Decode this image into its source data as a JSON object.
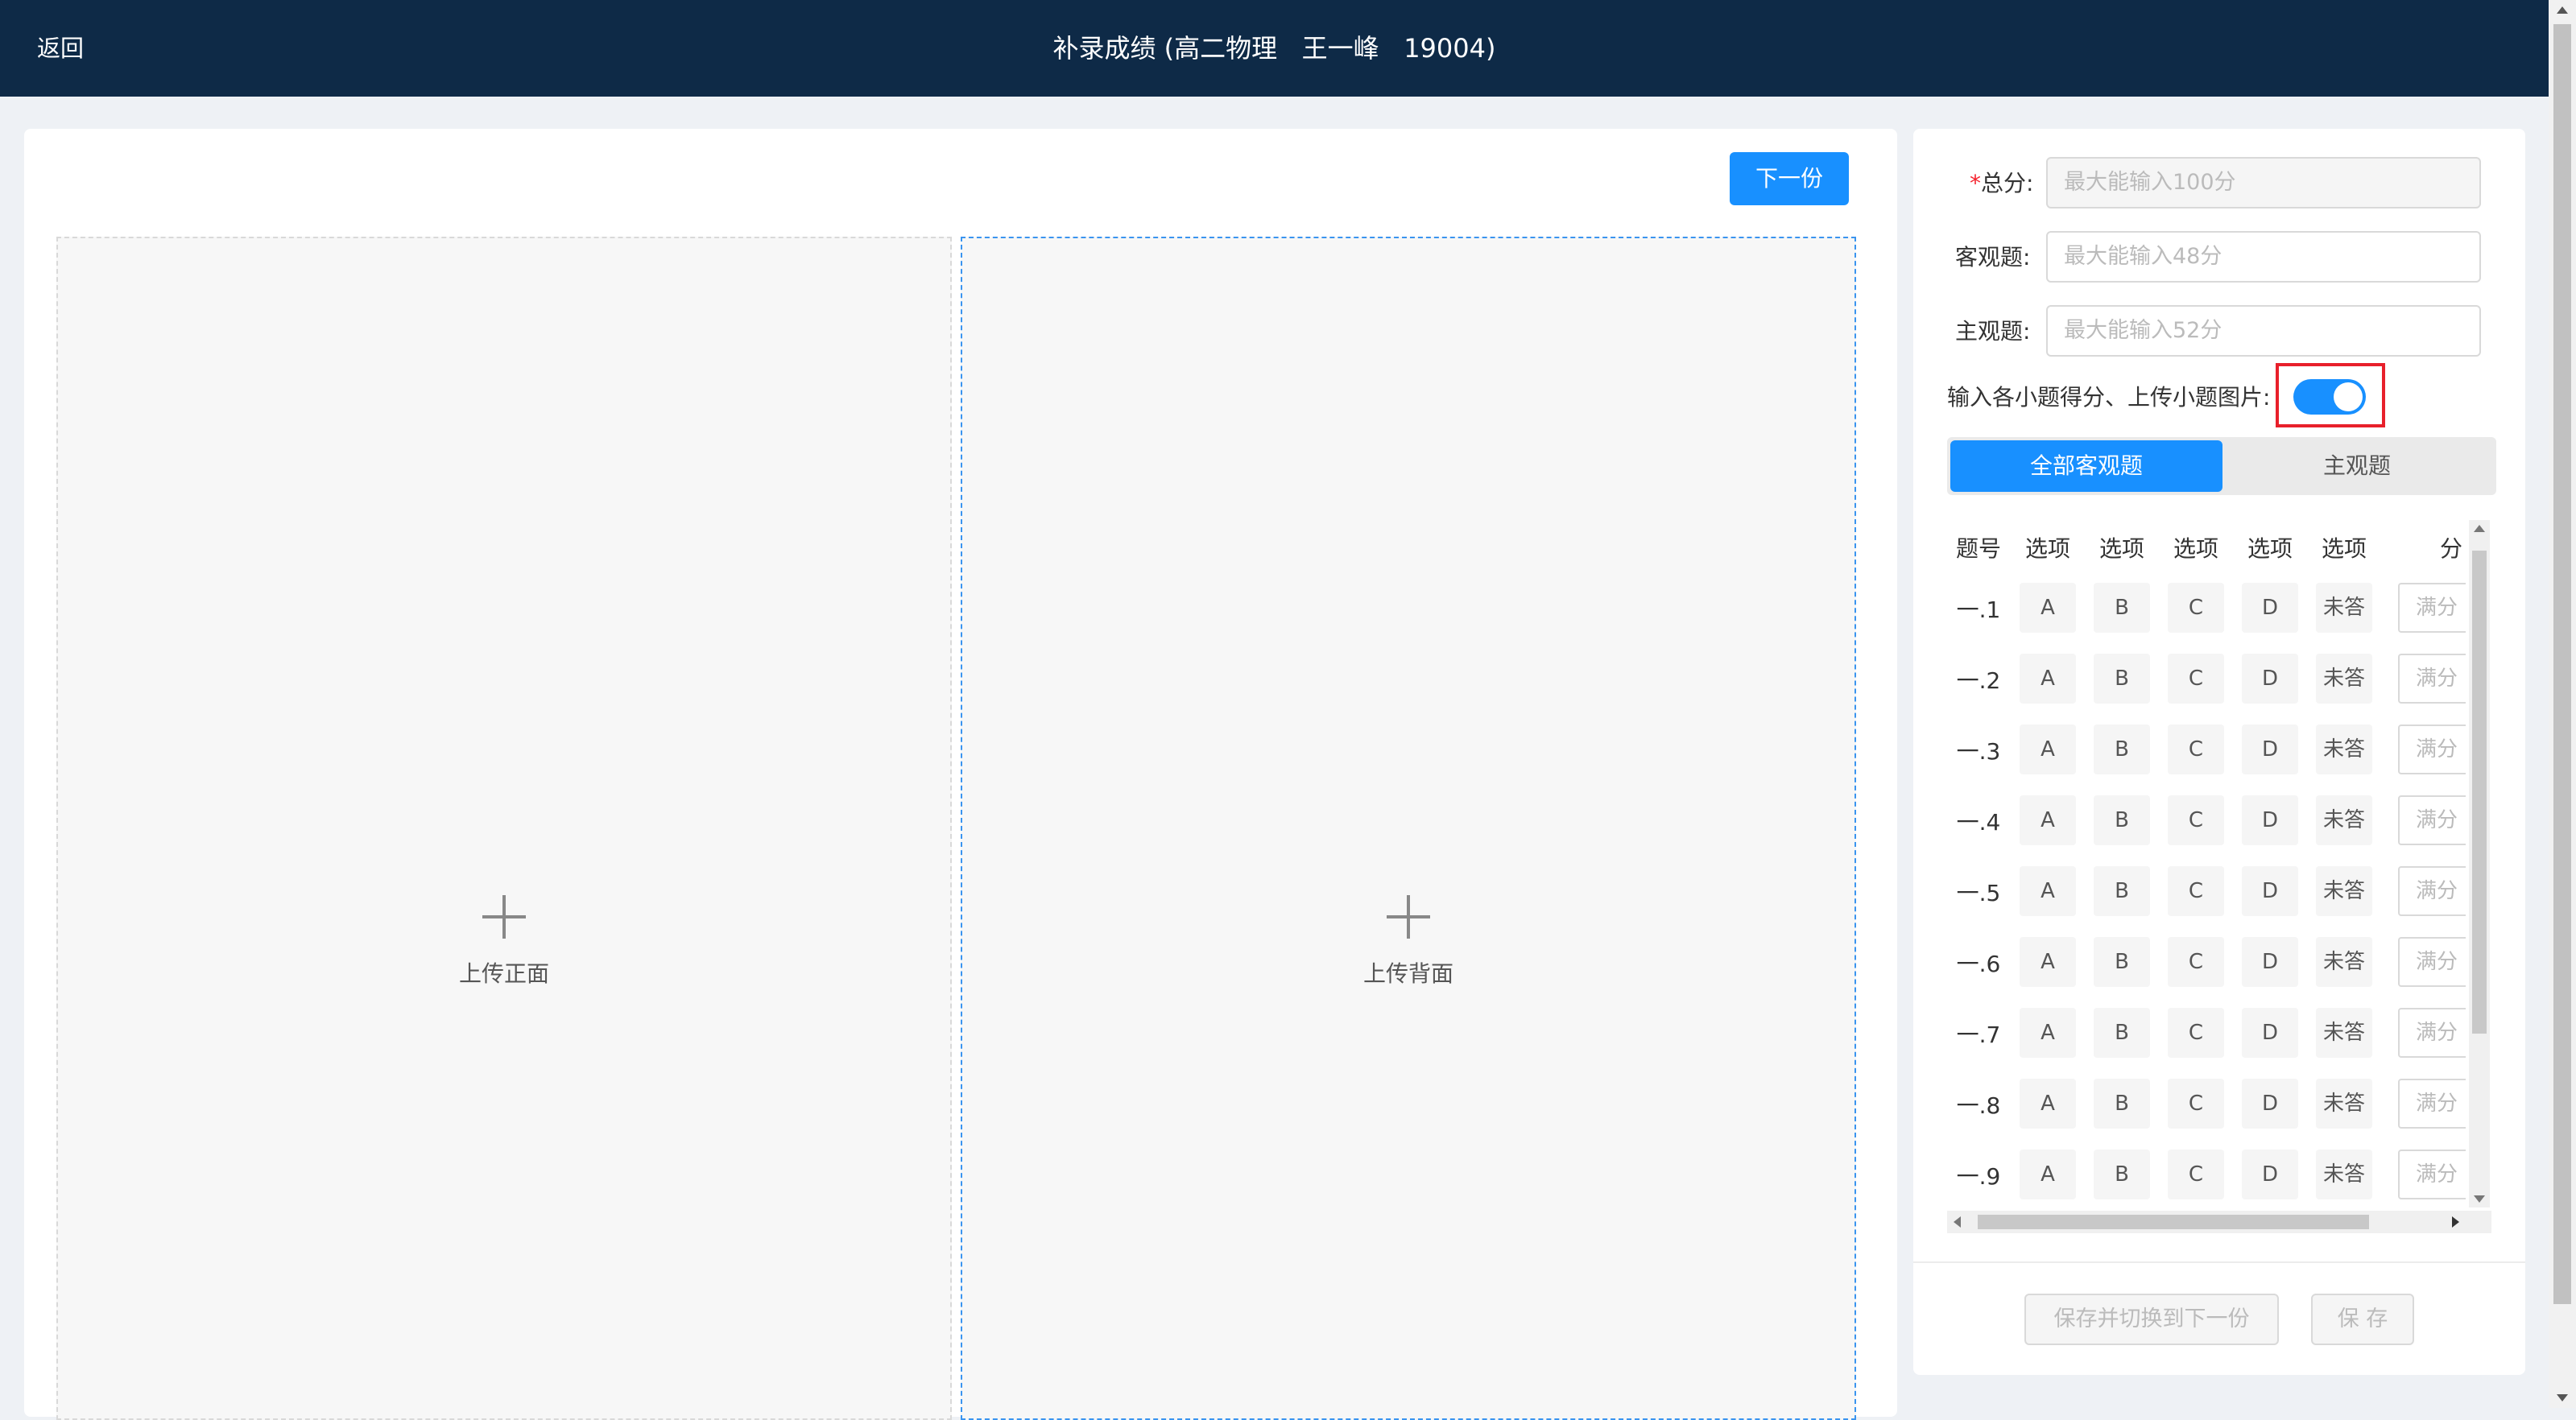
{
  "header": {
    "back_label": "返回",
    "title": "补录成绩 (高二物理   王一峰   19004)"
  },
  "left": {
    "next_label": "下一份",
    "upload_front_label": "上传正面",
    "upload_back_label": "上传背面"
  },
  "form": {
    "total": {
      "required_mark": "*",
      "label": "总分:",
      "placeholder": "最大能输入100分"
    },
    "objective": {
      "label": "客观题:",
      "placeholder": "最大能输入48分"
    },
    "subjective": {
      "label": "主观题:",
      "placeholder": "最大能输入52分"
    },
    "toggle_label": "输入各小题得分、上传小题图片:",
    "toggle_on": true
  },
  "tabs": [
    "全部客观题",
    "主观题"
  ],
  "table": {
    "headers": [
      "题号",
      "选项",
      "选项",
      "选项",
      "选项",
      "选项",
      "分"
    ],
    "options": [
      "A",
      "B",
      "C",
      "D",
      "未答"
    ],
    "score_placeholder": "满分",
    "rows": [
      "一.1",
      "一.2",
      "一.3",
      "一.4",
      "一.5",
      "一.6",
      "一.7",
      "一.8",
      "一.9"
    ]
  },
  "actions": {
    "save_next_label": "保存并切换到下一份",
    "save_label": "保 存"
  },
  "colors": {
    "header_bg": "#0e2a47",
    "primary": "#1890ff",
    "highlight_box": "#e8202b"
  }
}
